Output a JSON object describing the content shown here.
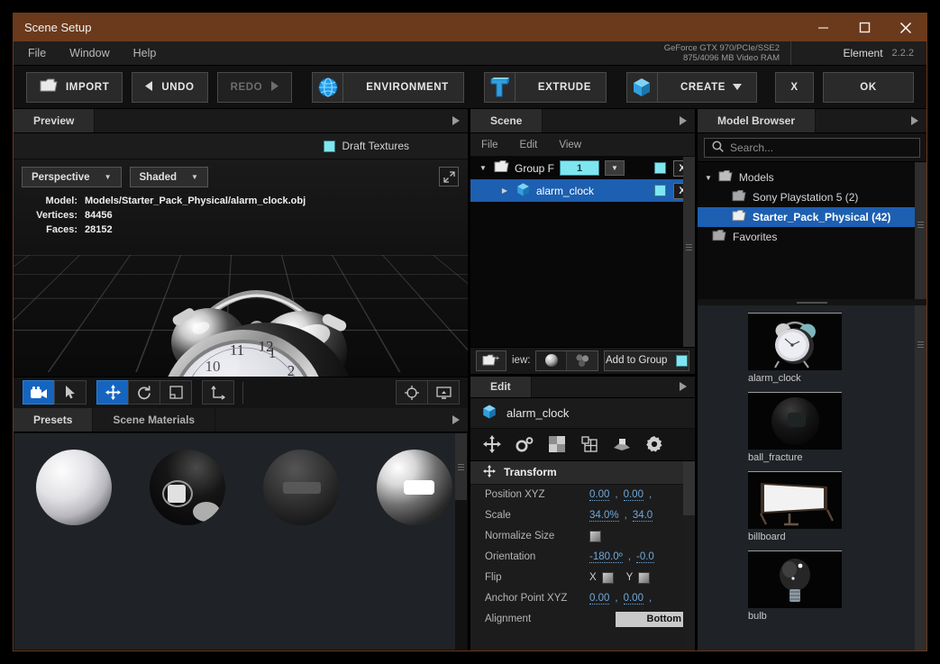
{
  "window": {
    "title": "Scene Setup",
    "minimize": "minimize-icon",
    "maximize": "maximize-icon",
    "close": "close-icon"
  },
  "menubar": {
    "items": [
      "File",
      "Window",
      "Help"
    ],
    "gpu_line1": "GeForce GTX 970/PCIe/SSE2",
    "gpu_line2": "875/4096 MB Video RAM",
    "product": "Element",
    "version": "2.2.2"
  },
  "toolbar": {
    "import": "IMPORT",
    "undo": "UNDO",
    "redo": "REDO",
    "environment": "ENVIRONMENT",
    "extrude": "EXTRUDE",
    "create": "CREATE",
    "cancel": "X",
    "ok": "OK"
  },
  "preview": {
    "tab": "Preview",
    "draft_textures": "Draft Textures",
    "draft_textures_checked": true,
    "camera": "Perspective",
    "shading": "Shaded",
    "info": [
      {
        "key": "Model:",
        "value": "Models/Starter_Pack_Physical/alarm_clock.obj"
      },
      {
        "key": "Vertices:",
        "value": "84456"
      },
      {
        "key": "Faces:",
        "value": "28152"
      }
    ],
    "tools": [
      {
        "name": "camera-tool",
        "active": true
      },
      {
        "name": "select-tool",
        "active": false
      },
      {
        "name": "move-tool",
        "active": true
      },
      {
        "name": "rotate-tool",
        "active": false
      },
      {
        "name": "scale-tool",
        "active": false
      },
      {
        "name": "axis-tool",
        "active": false
      },
      {
        "name": "focus-tool",
        "active": false
      },
      {
        "name": "fit-view-tool",
        "active": false
      }
    ]
  },
  "presets": {
    "tabs": [
      {
        "label": "Presets",
        "active": true
      },
      {
        "label": "Scene Materials",
        "active": false
      }
    ],
    "items": [
      {
        "label": "",
        "style": "matte-white"
      },
      {
        "label": "",
        "style": "black-eight-ball"
      },
      {
        "label": "",
        "style": "dark-gloss"
      },
      {
        "label": "",
        "style": "chrome"
      }
    ]
  },
  "scene": {
    "tab": "Scene",
    "menu": [
      "File",
      "Edit",
      "View"
    ],
    "rows": [
      {
        "name": "Group F",
        "icon": "folder-icon",
        "expander": "chevron-down-icon",
        "count": "1",
        "selected": false,
        "visible": true,
        "delete_label": "X"
      },
      {
        "name": "alarm_clock",
        "icon": "cube-icon",
        "expander": "chevron-right-icon",
        "count": null,
        "selected": true,
        "visible": true,
        "delete_label": "X"
      }
    ],
    "footer": {
      "new_group": "new-group-icon",
      "view_label": "iew:",
      "view_modes": [
        "sphere-preview-icon",
        "multi-preview-icon"
      ],
      "add_to_group": "Add to Group",
      "add_to_group_checked": true
    }
  },
  "edit": {
    "tab": "Edit",
    "object_name": "alarm_clock",
    "icons": [
      "transform-icon",
      "materials-icon",
      "texture-icon",
      "replicator-icon",
      "extrude-icon",
      "settings-icon"
    ],
    "section": "Transform",
    "properties": [
      {
        "label": "Position XYZ",
        "type": "numbers",
        "values": [
          "0.00",
          "0.00",
          ""
        ]
      },
      {
        "label": "Scale",
        "type": "numbers",
        "values": [
          "34.0%",
          "34.0"
        ]
      },
      {
        "label": "Normalize Size",
        "type": "checkbox",
        "checked": false
      },
      {
        "label": "Orientation",
        "type": "numbers",
        "values": [
          "-180.0º",
          "-0.0"
        ]
      },
      {
        "label": "Flip",
        "type": "flip",
        "axes": [
          "X",
          "Y"
        ]
      },
      {
        "label": "Anchor Point XYZ",
        "type": "numbers",
        "values": [
          "0.00",
          "0.00",
          ""
        ]
      },
      {
        "label": "Alignment",
        "type": "button",
        "value": "Bottom"
      }
    ]
  },
  "model_browser": {
    "tab": "Model Browser",
    "search_placeholder": "Search...",
    "search_value": "",
    "tree": [
      {
        "label": "Models",
        "level": 0,
        "expanded": true,
        "selected": false
      },
      {
        "label": "Sony Playstation 5 (2)",
        "level": 2,
        "expanded": false,
        "selected": false
      },
      {
        "label": "Starter_Pack_Physical (42)",
        "level": 2,
        "expanded": false,
        "selected": true
      },
      {
        "label": "Favorites",
        "level": 1,
        "expanded": false,
        "selected": false
      }
    ],
    "thumbnails": [
      {
        "label": "alarm_clock",
        "kind": "clock"
      },
      {
        "label": "ball_fracture",
        "kind": "ball"
      },
      {
        "label": "billboard",
        "kind": "billboard"
      },
      {
        "label": "bulb",
        "kind": "bulb"
      }
    ]
  },
  "colors": {
    "titlebar": "#6b3a1c",
    "accent_blue": "#1d5fb0",
    "cyan": "#7fe6f0",
    "value_blue": "#6fa8dc",
    "panel_bg": "#1c1c1c"
  }
}
